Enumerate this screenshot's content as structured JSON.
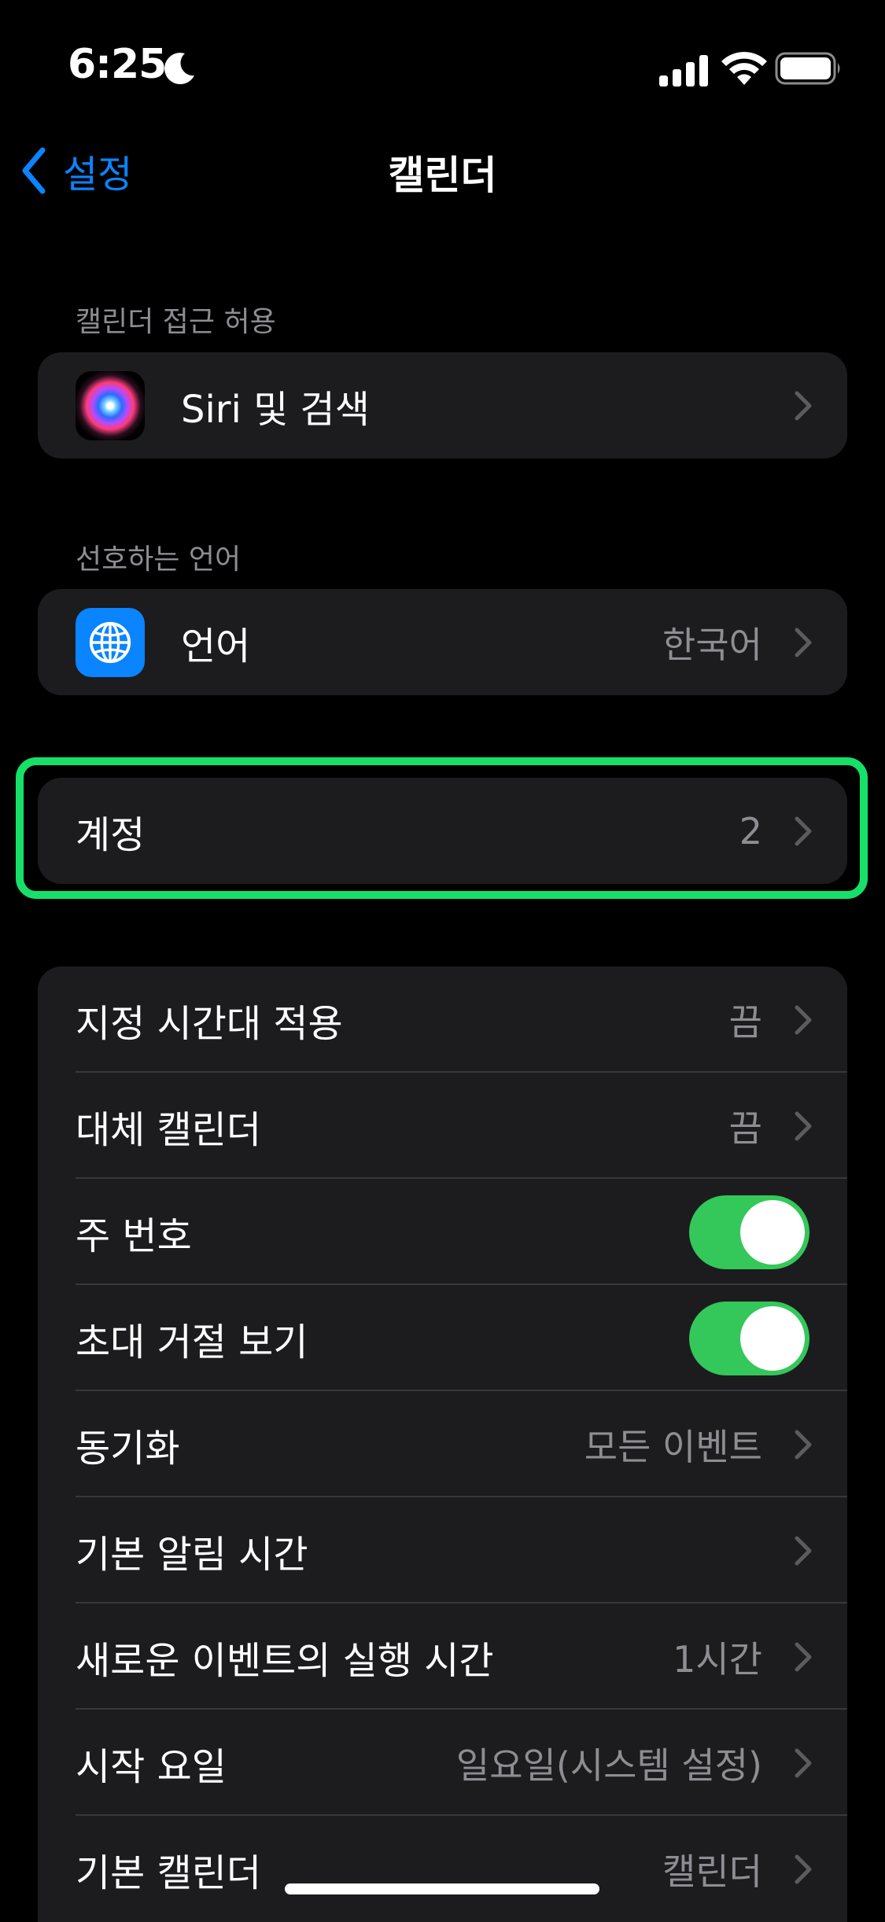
{
  "status_bar": {
    "time": "6:25"
  },
  "nav": {
    "back_label": "설정",
    "title": "캘린더"
  },
  "sections": {
    "access": {
      "header": "캘린더 접근 허용",
      "rows": [
        {
          "label": "Siri 및 검색",
          "icon": "siri-icon"
        }
      ]
    },
    "language": {
      "header": "선호하는 언어",
      "rows": [
        {
          "label": "언어",
          "value": "한국어",
          "icon": "globe-icon"
        }
      ]
    },
    "accounts": {
      "rows": [
        {
          "label": "계정",
          "value": "2"
        }
      ]
    },
    "settings": {
      "rows": [
        {
          "label": "지정 시간대 적용",
          "value": "끔"
        },
        {
          "label": "대체 캘린더",
          "value": "끔"
        },
        {
          "label": "주 번호",
          "toggle": true
        },
        {
          "label": "초대 거절 보기",
          "toggle": true
        },
        {
          "label": "동기화",
          "value": "모든 이벤트"
        },
        {
          "label": "기본 알림 시간",
          "value": ""
        },
        {
          "label": "새로운 이벤트의 실행 시간",
          "value": "1시간"
        },
        {
          "label": "시작 요일",
          "value": "일요일(시스템 설정)"
        },
        {
          "label": "기본 캘린더",
          "value": "캘린더"
        }
      ]
    }
  },
  "colors": {
    "accent": "#0a84ff",
    "toggle_on": "#34c759",
    "highlight": "#17e068"
  }
}
